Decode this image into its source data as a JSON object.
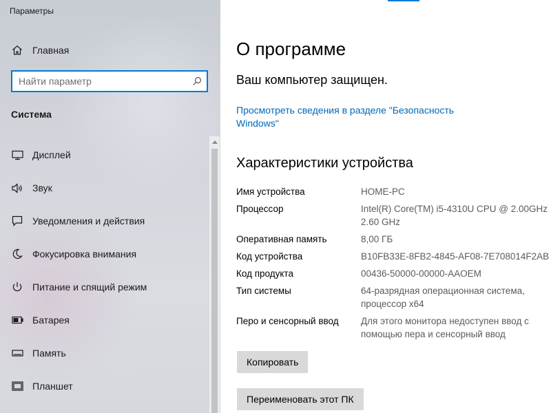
{
  "window": {
    "title": "Параметры"
  },
  "sidebar": {
    "home_label": "Главная",
    "search_placeholder": "Найти параметр",
    "section_title": "Система",
    "items": [
      {
        "label": "Дисплей",
        "icon": "monitor-icon"
      },
      {
        "label": "Звук",
        "icon": "speaker-icon"
      },
      {
        "label": "Уведомления и действия",
        "icon": "notification-icon"
      },
      {
        "label": "Фокусировка внимания",
        "icon": "moon-icon"
      },
      {
        "label": "Питание и спящий режим",
        "icon": "power-icon"
      },
      {
        "label": "Батарея",
        "icon": "battery-icon"
      },
      {
        "label": "Память",
        "icon": "storage-icon"
      },
      {
        "label": "Планшет",
        "icon": "tablet-icon"
      }
    ]
  },
  "main": {
    "title": "О программе",
    "protection_status": "Ваш компьютер защищен.",
    "security_link": "Просмотреть сведения в разделе \"Безопасность Windows\"",
    "specs_title": "Характеристики устройства",
    "specs": [
      {
        "key": "Имя устройства",
        "value": "HOME-PC"
      },
      {
        "key": "Процессор",
        "value": "Intel(R) Core(TM) i5-4310U CPU @ 2.00GHz 2.60 GHz"
      },
      {
        "key": "Оперативная память",
        "value": "8,00 ГБ"
      },
      {
        "key": "Код устройства",
        "value": "B10FB33E-8FB2-4845-AF08-7E708014F2AB"
      },
      {
        "key": "Код продукта",
        "value": "00436-50000-00000-AAOEM"
      },
      {
        "key": "Тип системы",
        "value": "64-разрядная операционная система, процессор x64"
      },
      {
        "key": "Перо и сенсорный ввод",
        "value": "Для этого монитора недоступен ввод с помощью пера и сенсорный ввод"
      }
    ],
    "copy_button": "Копировать",
    "rename_button": "Переименовать этот ПК"
  },
  "colors": {
    "accent": "#0078d7",
    "link": "#0068b8",
    "button_bg": "#d9d9d9",
    "value_text": "#5b5b5b"
  }
}
